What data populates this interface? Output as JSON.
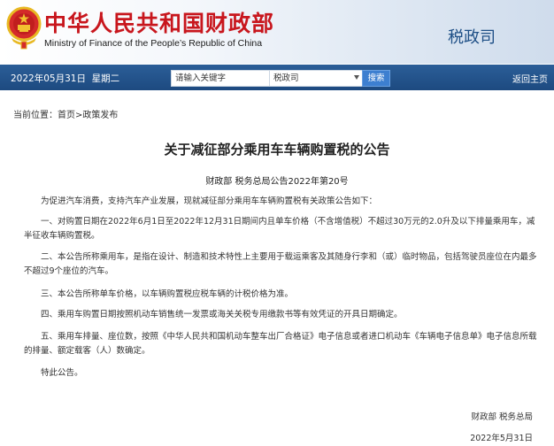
{
  "header": {
    "cn_title": "中华人民共和国财政部",
    "en_title": "Ministry of Finance of the People’s Republic of China",
    "dept": "税政司",
    "emblem_icon": "national-emblem-icon",
    "bg_color": "#dfe8f3",
    "title_color": "#c8161d"
  },
  "nav": {
    "date": "2022年05月31日",
    "weekday": "星期二",
    "search_placeholder": "请输入关键字",
    "scope_value": "税政司",
    "search_label": "搜索",
    "back_home": "返回主页",
    "bar_color": "#1d4a80"
  },
  "breadcrumb": {
    "prefix": "当前位置：",
    "home": "首页",
    "sep": ">",
    "section": "政策发布"
  },
  "article": {
    "title": "关于减征部分乘用车车辆购置税的公告",
    "doc_no": "财政部  税务总局公告2022年第20号",
    "paragraphs": [
      "为促进汽车消费，支持汽车产业发展，现就减征部分乘用车车辆购置税有关政策公告如下：",
      "一、对购置日期在2022年6月1日至2022年12月31日期间内且单车价格（不含增值税）不超过30万元的2.0升及以下排量乘用车，减半征收车辆购置税。",
      "二、本公告所称乘用车，是指在设计、制造和技术特性上主要用于载运乘客及其随身行李和（或）临时物品，包括驾驶员座位在内最多不超过9个座位的汽车。",
      "三、本公告所称单车价格，以车辆购置税应税车辆的计税价格为准。",
      "四、乘用车购置日期按照机动车销售统一发票或海关关税专用缴款书等有效凭证的开具日期确定。",
      "五、乘用车排量、座位数，按照《中华人民共和国机动车整车出厂合格证》电子信息或者进口机动车《车辆电子信息单》电子信息所载的排量、额定载客（人）数确定。",
      "特此公告。"
    ],
    "signature": "财政部  税务总局",
    "date": "2022年5月31日"
  }
}
